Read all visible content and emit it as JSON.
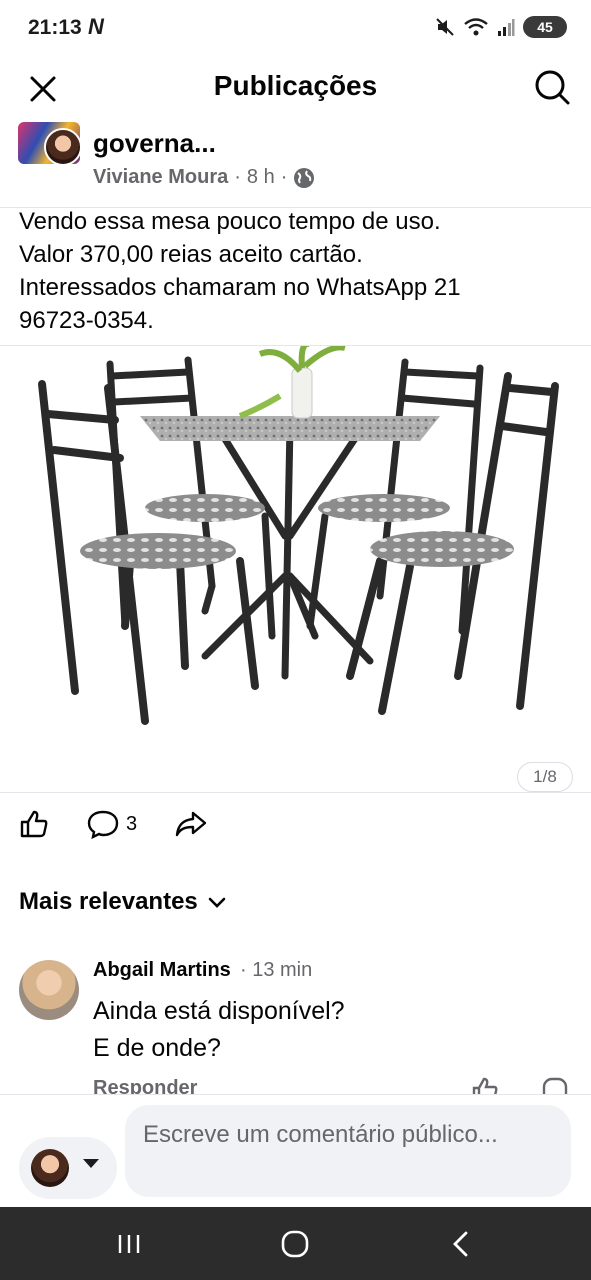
{
  "status_bar": {
    "time": "21:13",
    "carrier_glyph": "N",
    "battery": "45",
    "icons": [
      "mute-icon",
      "wifi-icon",
      "signal-icon",
      "battery-icon"
    ]
  },
  "header": {
    "title": "Publicações",
    "close_icon": "close-icon",
    "search_icon": "search-icon"
  },
  "post": {
    "group_name": "governa...",
    "author": "Viviane Moura",
    "time": "8 h",
    "separator": "·",
    "audience_icon": "globe-icon",
    "text_lines": [
      "Vendo essa mesa pouco tempo de uso.",
      "Valor 370,00 reias aceito cartão.",
      "Interessados chamaram no WhatsApp  21",
      "96723-0354."
    ],
    "photo_counter": "1/8"
  },
  "actions": {
    "like_icon": "like-icon",
    "comment_icon": "comment-icon",
    "comment_count": "3",
    "share_icon": "share-icon"
  },
  "sort": {
    "label": "Mais relevantes"
  },
  "comment": {
    "author": "Abgail Martins",
    "time": "· 13 min",
    "lines": [
      "Ainda está disponível?",
      "E de onde?"
    ],
    "reply_label": "Responder"
  },
  "composer": {
    "placeholder": "Escreve um comentário público..."
  },
  "navbar": {
    "icons": [
      "recent-apps-icon",
      "home-icon",
      "back-icon"
    ]
  },
  "colors": {
    "text": "#050505",
    "secondary": "#65676b",
    "divider": "#e4e6eb",
    "input_bg": "#f0f2f5",
    "navbar": "#2c2c2c"
  }
}
